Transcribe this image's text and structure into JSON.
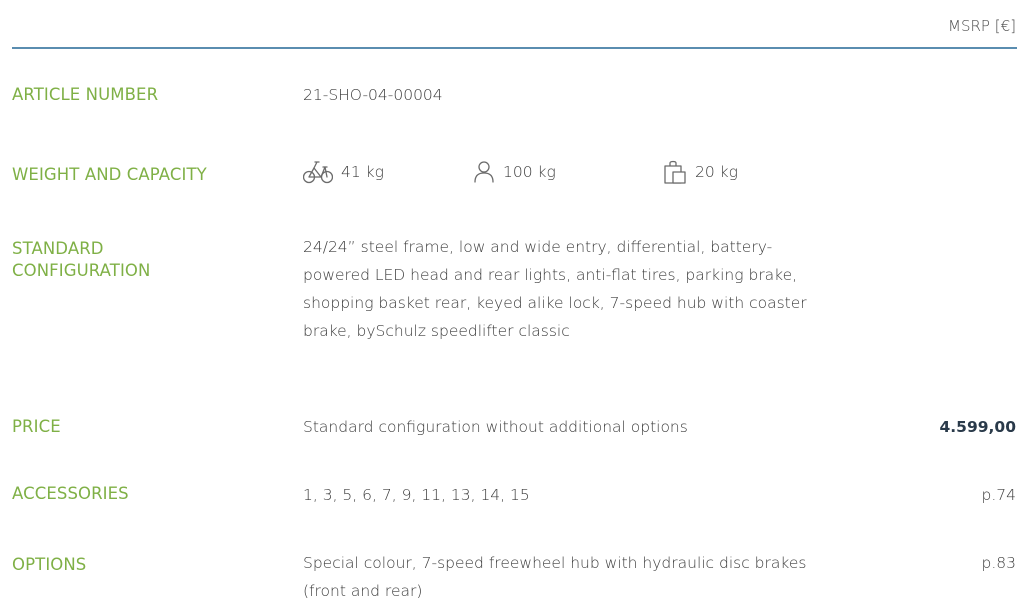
{
  "header": {
    "unit_label": "MSRP [€]"
  },
  "rows": {
    "article": {
      "label": "ARTICLE NUMBER",
      "value": "21-SHO-04-00004"
    },
    "weight": {
      "label": "WEIGHT AND CAPACITY",
      "items": [
        {
          "icon": "bicycle-icon",
          "value": "41 kg"
        },
        {
          "icon": "person-icon",
          "value": "100 kg"
        },
        {
          "icon": "shopping-bag-icon",
          "value": "20 kg"
        }
      ]
    },
    "standard": {
      "label_line1": "STANDARD",
      "label_line2": "CONFIGURATION",
      "lines": [
        "24/24” steel frame, low and wide entry, differential, battery-",
        "powered LED head and rear lights, anti-flat tires, parking brake,",
        "shopping basket rear, keyed alike lock, 7-speed hub with coaster",
        "brake, bySchulz speedlifter classic"
      ]
    },
    "price": {
      "label": "PRICE",
      "description": "Standard configuration without additional options",
      "amount": "4.599,00"
    },
    "accessories": {
      "label": "ACCESSORIES",
      "value": "1, 3, 5, 6, 7, 9, 11, 13, 14, 15",
      "page_ref": "p.74"
    },
    "options": {
      "label": "OPTIONS",
      "lines": [
        "Special colour, 7-speed freewheel hub with hydraulic disc brakes",
        "(front and rear)"
      ],
      "page_ref": "p.83"
    }
  },
  "colors": {
    "label_green": "#7fb046",
    "divider_blue": "#5a8db0",
    "text": "#3d3d3d"
  }
}
